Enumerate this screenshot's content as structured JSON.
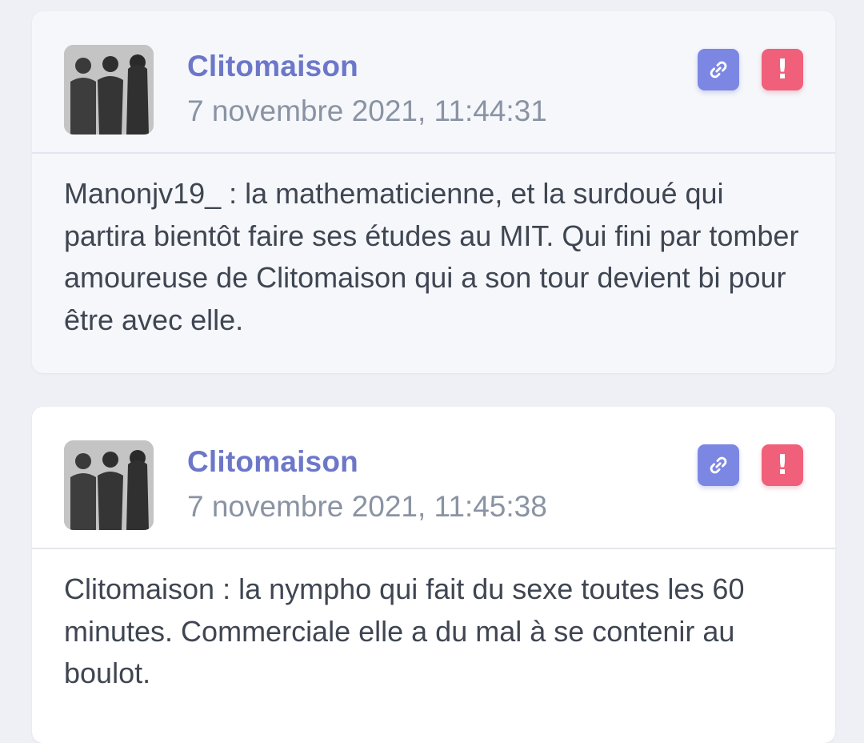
{
  "posts": [
    {
      "author": "Clitomaison",
      "timestamp": "7 novembre 2021, 11:44:31",
      "message": "Manonjv19_ : la mathematicienne, et la surdoué qui partira bientôt faire ses études au MIT. Qui fini par tomber amoureuse de Clitomaison qui a son tour devient bi pour être avec elle.",
      "report_glyph": "!"
    },
    {
      "author": "Clitomaison",
      "timestamp": "7 novembre 2021, 11:45:38",
      "message": "Clitomaison : la nympho qui fait du sexe toutes les 60 minutes. Commerciale elle a du mal à se contenir au boulot.",
      "report_glyph": "!"
    }
  ],
  "colors": {
    "author": "#6d77c9",
    "timestamp": "#8a93a3",
    "link_button": "#7c87e3",
    "report_button": "#f0607a",
    "message_text": "#3f4652"
  },
  "icons": {
    "link_button": "link-icon",
    "report_button": "exclamation-icon"
  }
}
